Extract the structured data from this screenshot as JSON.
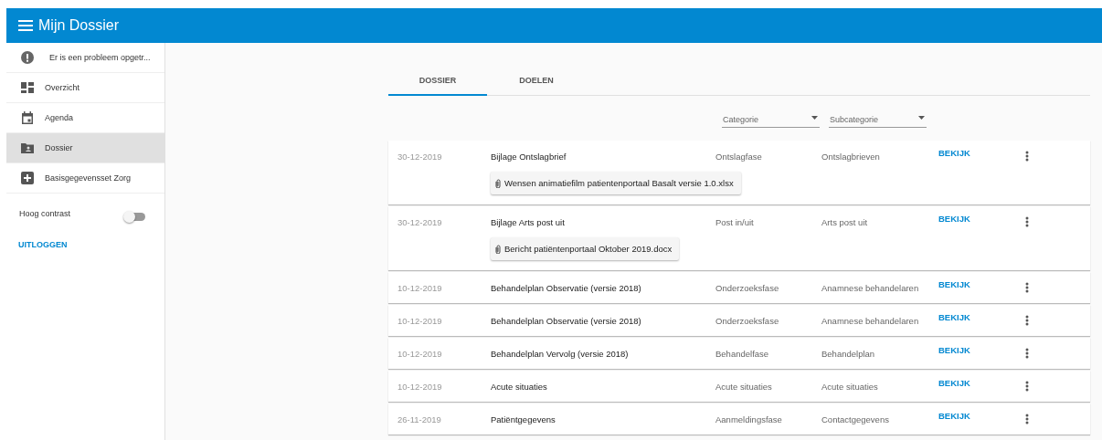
{
  "app_bar": {
    "title": "Mijn Dossier"
  },
  "sidebar": {
    "items": [
      {
        "kind": "alert",
        "label": "Er is een probleem opgetr...",
        "selected": false
      },
      {
        "kind": "dashboard",
        "label": "Overzicht",
        "selected": false
      },
      {
        "kind": "calendar",
        "label": "Agenda",
        "selected": false
      },
      {
        "kind": "folder",
        "label": "Dossier",
        "selected": true
      },
      {
        "kind": "plus",
        "label": "Basisgegevensset Zorg",
        "selected": false
      }
    ],
    "toggle": {
      "label": "Hoog contrast",
      "on": false
    },
    "logout": "UITLOGGEN"
  },
  "tabs": [
    {
      "label": "DOSSIER",
      "selected": true
    },
    {
      "label": "DOELEN",
      "selected": false
    }
  ],
  "filters": [
    {
      "placeholder": "Categorie"
    },
    {
      "placeholder": "Subcategorie"
    }
  ],
  "documents": [
    {
      "date": "30-12-2019",
      "title": "Bijlage Ontslagbrief",
      "category": "Ontslagfase",
      "subcategory": "Ontslagbrieven",
      "action": "BEKIJK",
      "attachment": "Wensen animatiefilm patientenportaal Basalt versie 1.0.xlsx"
    },
    {
      "date": "30-12-2019",
      "title": "Bijlage Arts post uit",
      "category": "Post in/uit",
      "subcategory": "Arts post uit",
      "action": "BEKIJK",
      "attachment": "Bericht patiëntenportaal Oktober 2019.docx"
    },
    {
      "date": "10-12-2019",
      "title": "Behandelplan Observatie (versie 2018)",
      "category": "Onderzoeksfase",
      "subcategory": "Anamnese behandelaren",
      "action": "BEKIJK"
    },
    {
      "date": "10-12-2019",
      "title": "Behandelplan Observatie (versie 2018)",
      "category": "Onderzoeksfase",
      "subcategory": "Anamnese behandelaren",
      "action": "BEKIJK"
    },
    {
      "date": "10-12-2019",
      "title": "Behandelplan Vervolg (versie 2018)",
      "category": "Behandelfase",
      "subcategory": "Behandelplan",
      "action": "BEKIJK"
    },
    {
      "date": "10-12-2019",
      "title": "Acute situaties",
      "category": "Acute situaties",
      "subcategory": "Acute situaties",
      "action": "BEKIJK"
    },
    {
      "date": "26-11-2019",
      "title": "Patiëntgegevens",
      "category": "Aanmeldingsfase",
      "subcategory": "Contactgegevens",
      "action": "BEKIJK"
    }
  ]
}
